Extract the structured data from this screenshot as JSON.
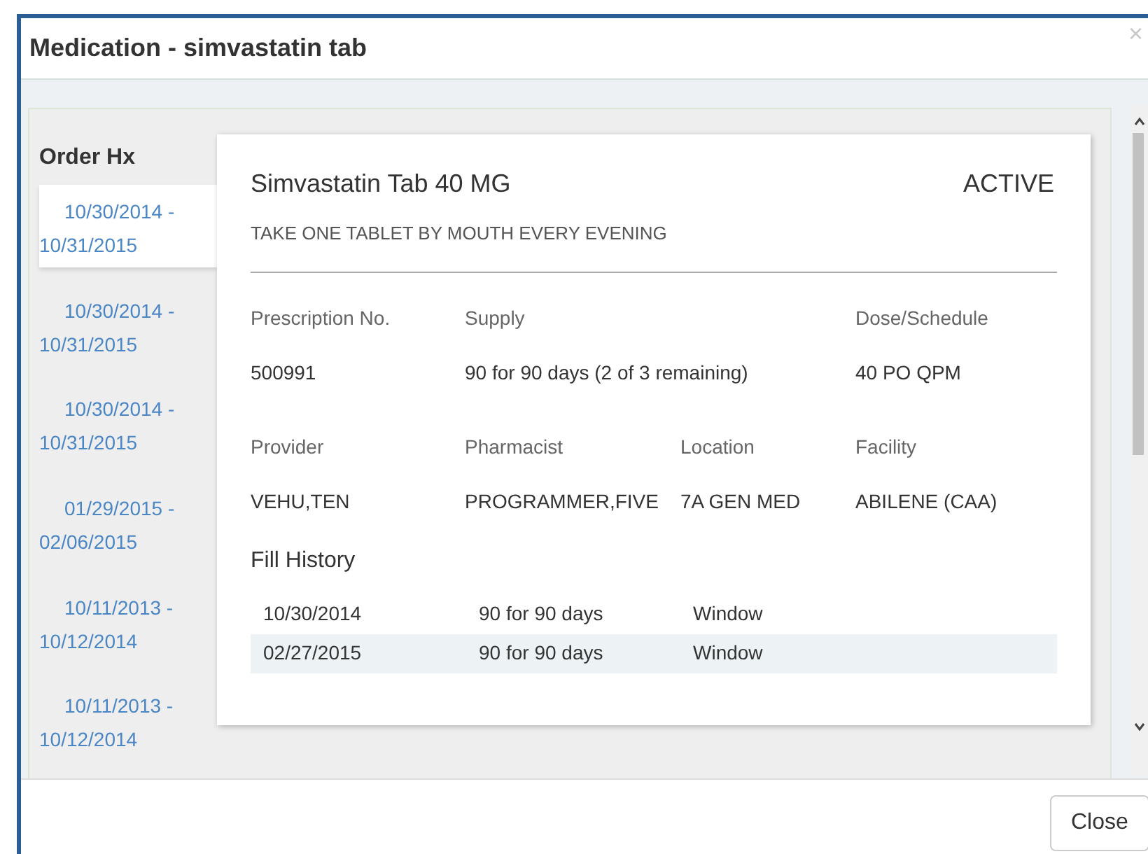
{
  "dialog": {
    "title": "Medication - simvastatin tab",
    "close_glyph": "×"
  },
  "order_hx": {
    "heading": "Order Hx",
    "items": [
      {
        "label": "10/30/2014 - 10/31/2015",
        "selected": true
      },
      {
        "label": "10/30/2014 - 10/31/2015",
        "selected": false
      },
      {
        "label": "10/30/2014 - 10/31/2015",
        "selected": false
      },
      {
        "label": "01/29/2015 - 02/06/2015",
        "selected": false
      },
      {
        "label": "10/11/2013 - 10/12/2014",
        "selected": false
      },
      {
        "label": "10/11/2013 - 10/12/2014",
        "selected": false
      }
    ]
  },
  "detail": {
    "name": "Simvastatin Tab 40 MG",
    "status": "ACTIVE",
    "sig": "TAKE ONE TABLET BY MOUTH EVERY EVENING",
    "field_rows": [
      [
        {
          "label": "Prescription No.",
          "value": "500991"
        },
        {
          "label": "Supply",
          "value": "90 for 90 days (2 of 3 remaining)"
        },
        {
          "label": "Dose/Schedule",
          "value": "40 PO QPM"
        }
      ],
      [
        {
          "label": "Provider",
          "value": "VEHU,TEN"
        },
        {
          "label": "Pharmacist",
          "value": "PROGRAMMER,FIVE"
        },
        {
          "label": "Location",
          "value": "7A GEN MED"
        },
        {
          "label": "Facility",
          "value": "ABILENE (CAA)"
        }
      ]
    ],
    "fill_history": {
      "heading": "Fill History",
      "rows": [
        {
          "date": "10/30/2014",
          "quantity": "90 for 90 days",
          "routing": "Window"
        },
        {
          "date": "02/27/2015",
          "quantity": "90 for 90 days",
          "routing": "Window"
        }
      ]
    }
  },
  "footer": {
    "close_button": "Close"
  }
}
